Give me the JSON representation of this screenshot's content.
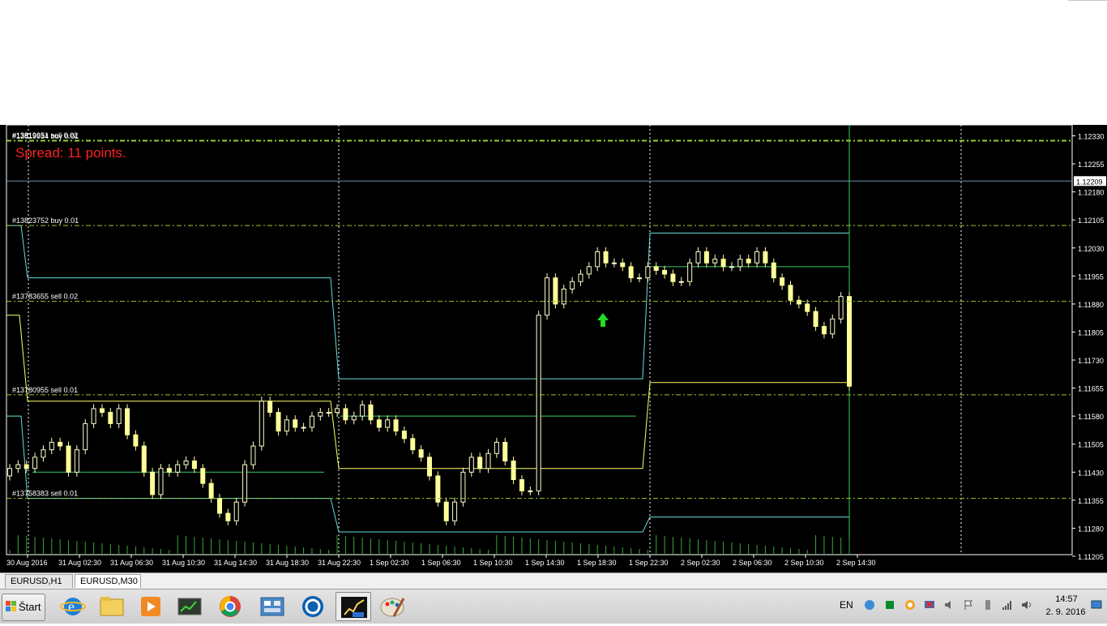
{
  "chart_data": {
    "type": "candlestick",
    "symbol": "EURUSD",
    "timeframe": "M30",
    "spread_label": "Spread: 11 points.",
    "current_price": "1.12209",
    "price_axis_ticks": [
      "1.12330",
      "1.12255",
      "1.12180",
      "1.12105",
      "1.12030",
      "1.11955",
      "1.11880",
      "1.11805",
      "1.11730",
      "1.11655",
      "1.11580",
      "1.11505",
      "1.11430",
      "1.11355",
      "1.11280",
      "1.11205"
    ],
    "time_axis_ticks": [
      "30 Aug 2016",
      "31 Aug 02:30",
      "31 Aug 06:30",
      "31 Aug 10:30",
      "31 Aug 14:30",
      "31 Aug 18:30",
      "31 Aug 22:30",
      "1 Sep 02:30",
      "1 Sep 06:30",
      "1 Sep 10:30",
      "1 Sep 14:30",
      "1 Sep 18:30",
      "1 Sep 22:30",
      "2 Sep 02:30",
      "2 Sep 06:30",
      "2 Sep 10:30",
      "2 Sep 14:30"
    ],
    "order_labels": [
      "#13819651 sell 0.02",
      "#13819934 buy 0.01",
      "#13823752 buy 0.01",
      "#13783655 sell 0.02",
      "#13780955 sell 0.01",
      "#13758383 sell 0.01"
    ],
    "order_levels": [
      1.12318,
      1.12316,
      1.1209,
      1.11887,
      1.11637,
      1.1136
    ],
    "ohlc_close_approx": [
      1.1144,
      1.1145,
      1.1144,
      1.1147,
      1.1149,
      1.1151,
      1.115,
      1.1143,
      1.1149,
      1.1156,
      1.116,
      1.1159,
      1.1156,
      1.116,
      1.1153,
      1.115,
      1.1143,
      1.1137,
      1.1144,
      1.1143,
      1.1145,
      1.1146,
      1.1144,
      1.114,
      1.1136,
      1.1132,
      1.113,
      1.1135,
      1.1145,
      1.115,
      1.1162,
      1.1159,
      1.1154,
      1.1157,
      1.1155,
      1.1155,
      1.1158,
      1.1159,
      1.1159,
      1.116,
      1.1157,
      1.1158,
      1.1161,
      1.1157,
      1.1155,
      1.1157,
      1.1154,
      1.1152,
      1.1149,
      1.1147,
      1.1142,
      1.1135,
      1.113,
      1.1135,
      1.1143,
      1.1147,
      1.1144,
      1.1148,
      1.1151,
      1.1146,
      1.1141,
      1.1138,
      1.1138,
      1.1185,
      1.1195,
      1.1188,
      1.1192,
      1.1194,
      1.1196,
      1.1198,
      1.1202,
      1.1199,
      1.1199,
      1.1198,
      1.1195,
      1.1195,
      1.1198,
      1.1197,
      1.1196,
      1.1194,
      1.1194,
      1.1199,
      1.1202,
      1.1199,
      1.12,
      1.1198,
      1.1198,
      1.12,
      1.1199,
      1.1202,
      1.1199,
      1.1195,
      1.1193,
      1.1189,
      1.1188,
      1.1186,
      1.1182,
      1.118,
      1.1184,
      1.119,
      1.1166
    ],
    "colors": {
      "background": "#000000",
      "bull_candle": "#ffffcc",
      "bear_candle": "#ffff99",
      "grid": "#ffffff",
      "order_line": "#99cc33",
      "cyan_band": "#66dddd",
      "yellow_band": "#ffff66",
      "green_level": "#33cc66",
      "volume": "#33aa33",
      "spread_text": "#ff2020",
      "buy_arrow": "#22dd22"
    }
  },
  "tabs": [
    {
      "label": "EURUSD,H1",
      "active": false
    },
    {
      "label": "EURUSD,M30",
      "active": true
    }
  ],
  "taskbar": {
    "start_label": "Štart",
    "apps": [
      "internet-explorer-icon",
      "file-explorer-icon",
      "media-player-icon",
      "terminal-chart-icon",
      "chrome-icon",
      "control-panel-icon",
      "teamviewer-icon",
      "metatrader-icon",
      "paint-icon"
    ],
    "tray_lang": "EN",
    "clock_time": "14:57",
    "clock_date": "2. 9. 2016"
  }
}
